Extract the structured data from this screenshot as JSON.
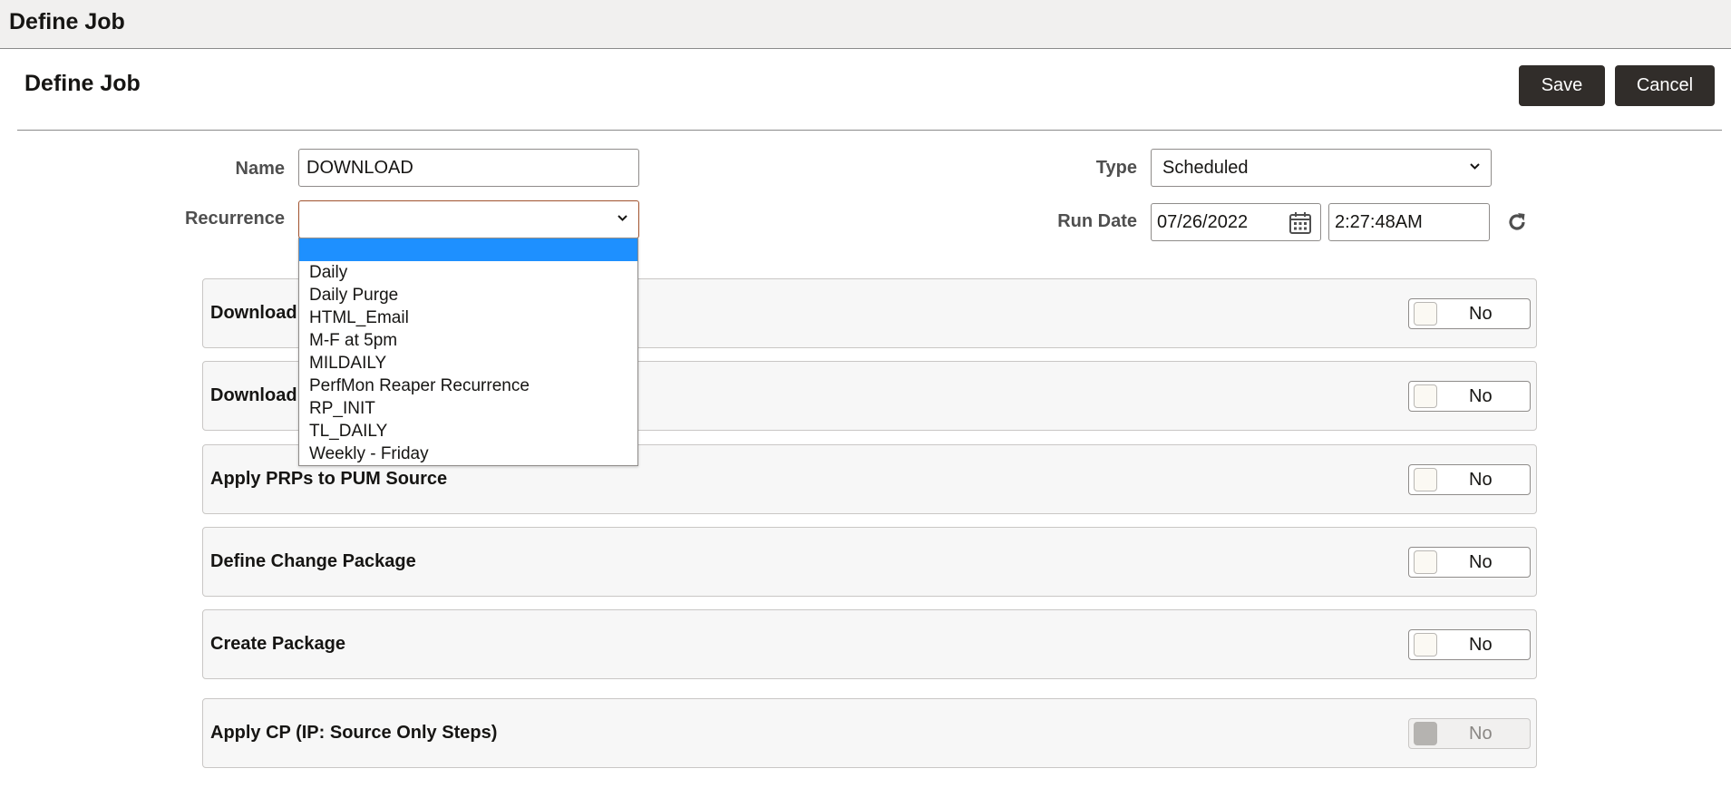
{
  "topbar": {
    "title": "Define Job"
  },
  "page": {
    "title": "Define Job"
  },
  "toolbar": {
    "save_label": "Save",
    "cancel_label": "Cancel"
  },
  "form": {
    "name": {
      "label": "Name",
      "value": "DOWNLOAD"
    },
    "type": {
      "label": "Type",
      "value": "Scheduled"
    },
    "recurrence": {
      "label": "Recurrence",
      "value": "",
      "options": [
        "",
        "Daily",
        "Daily Purge",
        "HTML_Email",
        "M-F at 5pm",
        "MILDAILY",
        "PerfMon Reaper Recurrence",
        "RP_INIT",
        "TL_DAILY",
        "Weekly - Friday"
      ]
    },
    "run_date": {
      "label": "Run Date",
      "date": "07/26/2022",
      "time": "2:27:48AM"
    }
  },
  "steps": [
    {
      "label": "Download",
      "toggle": "No",
      "enabled": true
    },
    {
      "label": "Download",
      "toggle": "No",
      "enabled": true
    },
    {
      "label": "Apply PRPs to PUM Source",
      "toggle": "No",
      "enabled": true
    },
    {
      "label": "Define Change Package",
      "toggle": "No",
      "enabled": true
    },
    {
      "label": "Create Package",
      "toggle": "No",
      "enabled": true
    },
    {
      "label": "Apply CP (IP: Source Only Steps)",
      "toggle": "No",
      "enabled": false
    }
  ],
  "icons": {
    "calendar": "calendar-icon",
    "refresh": "refresh-icon",
    "chevron": "chevron-down-icon"
  },
  "colors": {
    "primary_button": "#312d2a",
    "selected_option": "#1e90ff",
    "focused_border": "#a0522d"
  }
}
